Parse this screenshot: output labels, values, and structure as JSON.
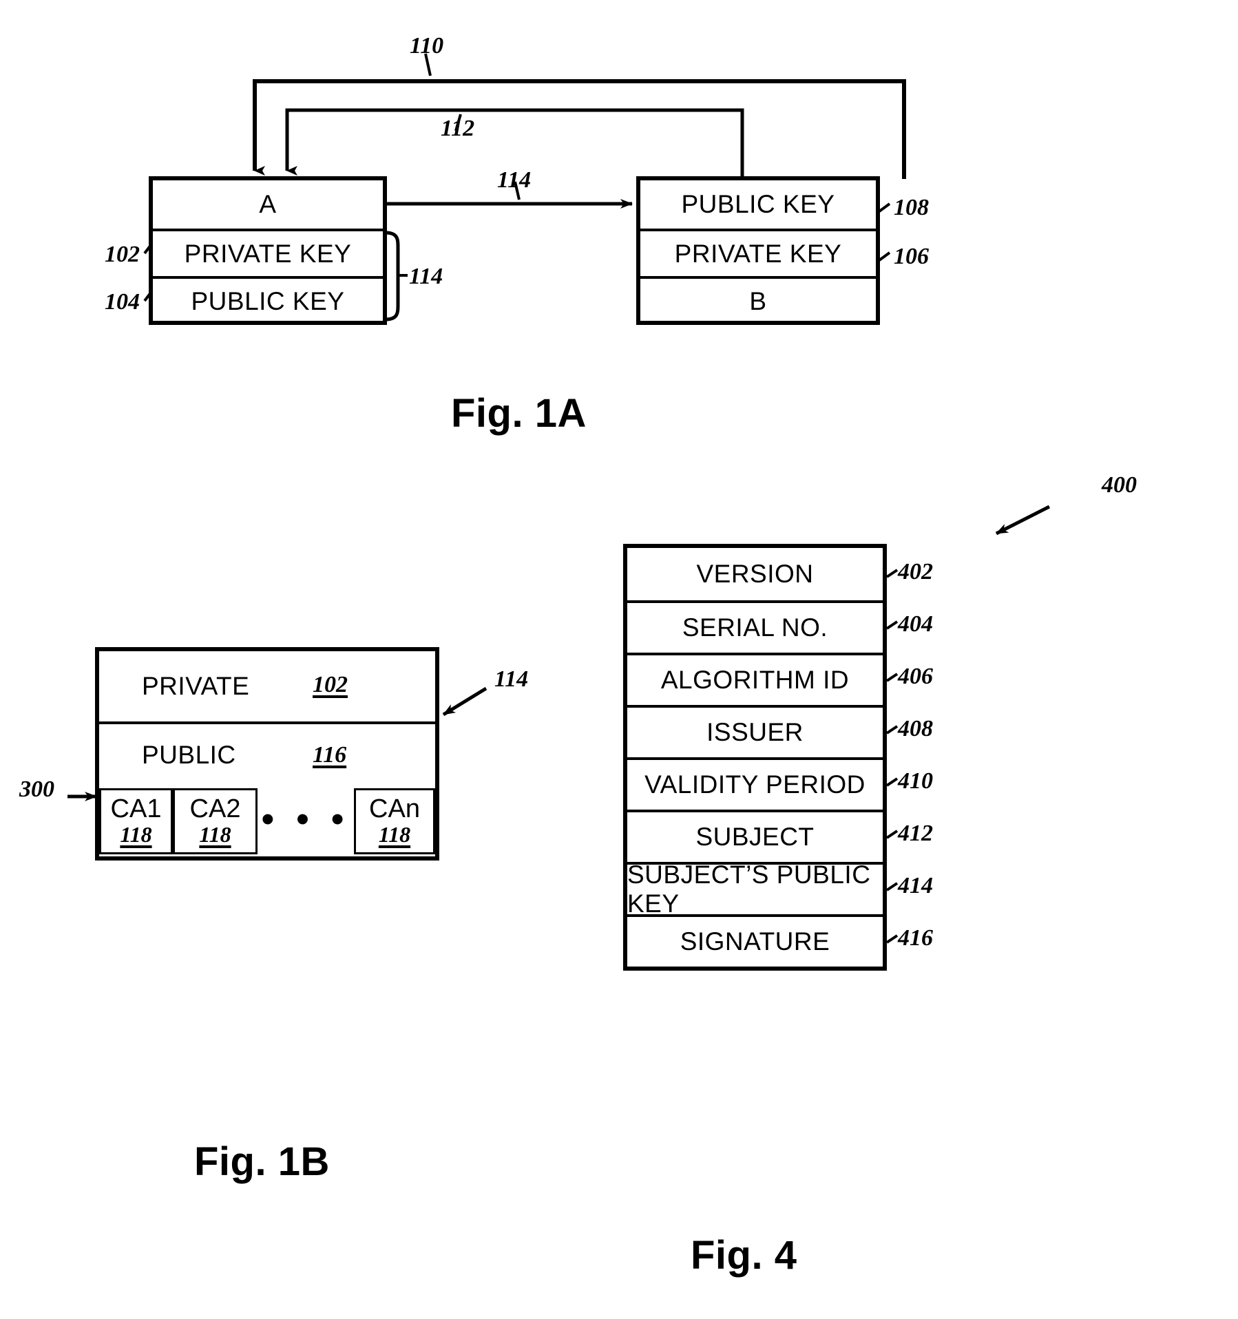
{
  "figures": [
    {
      "id": "fig-1a",
      "caption": "Fig. 1A",
      "entity_a": {
        "rows": [
          {
            "label": "A",
            "ref": ""
          },
          {
            "label": "PRIVATE KEY",
            "ref": "102"
          },
          {
            "label": "PUBLIC KEY",
            "ref": "104"
          }
        ],
        "bracket_ref": "114"
      },
      "entity_b": {
        "rows": [
          {
            "label": "PUBLIC KEY",
            "ref": "108"
          },
          {
            "label": "PRIVATE KEY",
            "ref": "106"
          },
          {
            "label": "B",
            "ref": ""
          }
        ]
      },
      "connectors": [
        {
          "ref": "110"
        },
        {
          "ref": "112"
        },
        {
          "ref": "114"
        }
      ]
    },
    {
      "id": "fig-1b",
      "caption": "Fig. 1B",
      "outer_ref": "114",
      "pointer_ref": "300",
      "rows": [
        {
          "label": "PRIVATE",
          "ref": "102"
        },
        {
          "label": "PUBLIC",
          "ref": "116"
        }
      ],
      "ca_cells": [
        {
          "name": "CA1",
          "ref": "118"
        },
        {
          "name": "CA2",
          "ref": "118"
        },
        {
          "name": "…",
          "ref": ""
        },
        {
          "name": "CAn",
          "ref": "118"
        }
      ],
      "ellipsis": "• • •"
    },
    {
      "id": "fig-4",
      "caption": "Fig. 4",
      "outer_ref": "400",
      "rows": [
        {
          "label": "VERSION",
          "ref": "402"
        },
        {
          "label": "SERIAL NO.",
          "ref": "404"
        },
        {
          "label": "ALGORITHM ID",
          "ref": "406"
        },
        {
          "label": "ISSUER",
          "ref": "408"
        },
        {
          "label": "VALIDITY PERIOD",
          "ref": "410"
        },
        {
          "label": "SUBJECT",
          "ref": "412"
        },
        {
          "label": "SUBJECT’S PUBLIC KEY",
          "ref": "414"
        },
        {
          "label": "SIGNATURE",
          "ref": "416"
        }
      ]
    }
  ],
  "colors": {
    "ink": "#000000",
    "paper": "#ffffff"
  }
}
